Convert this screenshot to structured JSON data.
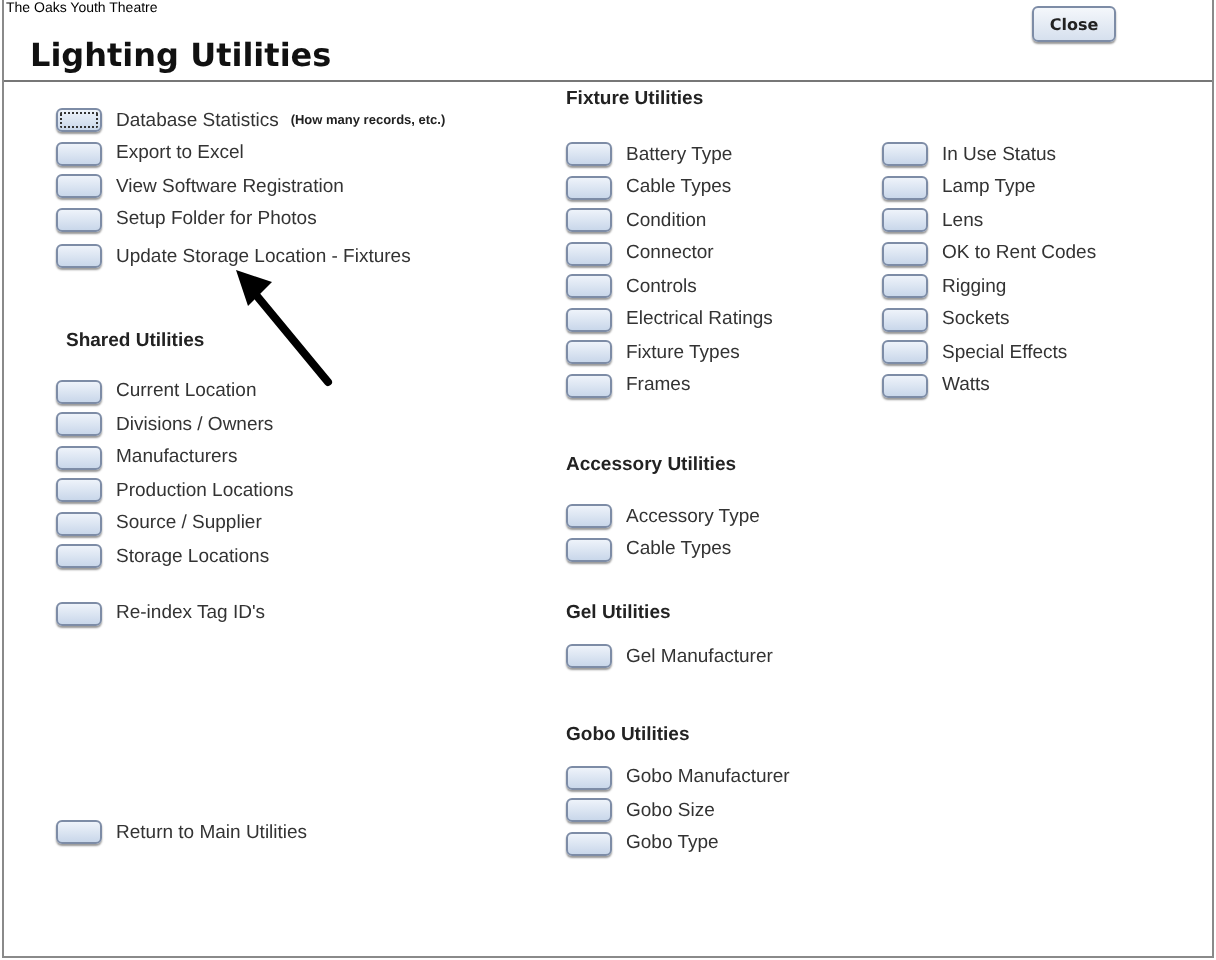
{
  "window": {
    "caption": "The Oaks Youth Theatre",
    "title": "Lighting Utilities"
  },
  "close_button": "Close",
  "general": [
    {
      "label": "Database Statistics",
      "note": "(How many records, etc.)",
      "focused": true
    },
    {
      "label": "Export to Excel",
      "focused": false
    },
    {
      "label": "View Software Registration",
      "focused": false
    },
    {
      "label": "Setup Folder for Photos",
      "focused": false
    },
    {
      "label": "Update Storage Location - Fixtures",
      "focused": false
    }
  ],
  "shared_utilities": {
    "title": "Shared Utilities",
    "items": [
      "Current Location",
      "Divisions / Owners",
      "Manufacturers",
      "Production Locations",
      "Source / Supplier",
      "Storage Locations"
    ]
  },
  "reindex": "Re-index Tag ID's",
  "return": "Return to Main Utilities",
  "fixture_utilities": {
    "title": "Fixture Utilities",
    "items": [
      "Battery Type",
      "Cable Types",
      "Condition",
      "Connector",
      "Controls",
      "Electrical Ratings",
      "Fixture Types",
      "Frames",
      "In Use Status",
      "Lamp Type",
      "Lens",
      "OK to Rent Codes",
      "Rigging",
      "Sockets",
      "Special Effects",
      "Watts"
    ]
  },
  "accessory_utilities": {
    "title": "Accessory Utilities",
    "items": [
      "Accessory Type",
      "Cable Types"
    ]
  },
  "gel_utilities": {
    "title": "Gel Utilities",
    "items": [
      "Gel Manufacturer"
    ]
  },
  "gobo_utilities": {
    "title": "Gobo Utilities",
    "items": [
      "Gobo Manufacturer",
      "Gobo Size",
      "Gobo Type"
    ]
  }
}
